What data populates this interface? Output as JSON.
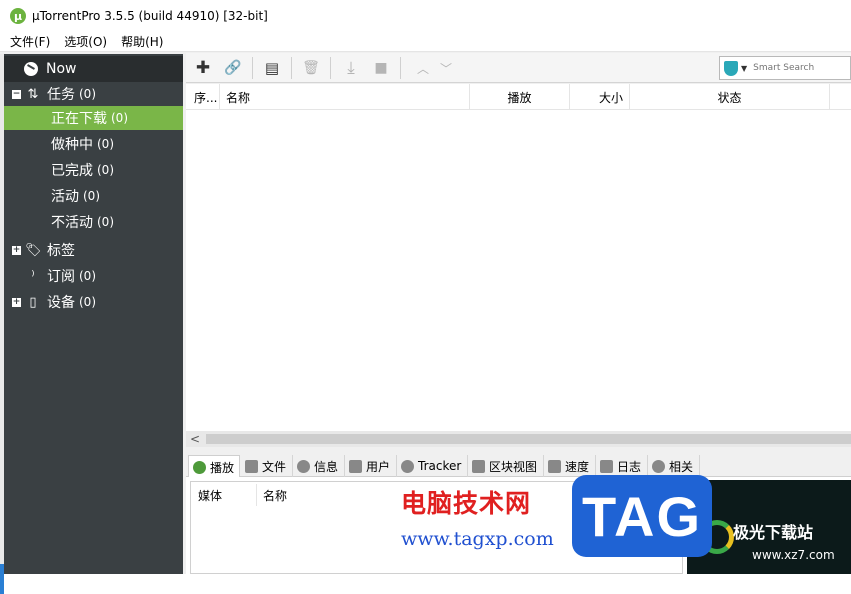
{
  "window": {
    "title": "µTorrentPro 3.5.5  (build 44910) [32-bit]",
    "logo_letter": "µ"
  },
  "menu": [
    "文件(F)",
    "选项(O)",
    "帮助(H)"
  ],
  "sidebar": {
    "now_label": "Now",
    "tasks": {
      "label": "任务",
      "count": "(0)",
      "expander": "−"
    },
    "task_items": [
      {
        "label": "正在下载",
        "count": "(0)",
        "selected": true
      },
      {
        "label": "做种中",
        "count": "(0)",
        "selected": false
      },
      {
        "label": "已完成",
        "count": "(0)",
        "selected": false
      },
      {
        "label": "活动",
        "count": "(0)",
        "selected": false
      },
      {
        "label": "不活动",
        "count": "(0)",
        "selected": false
      }
    ],
    "labels": {
      "label": "标签",
      "expander": "+"
    },
    "feeds": {
      "label": "订阅",
      "count": "(0)"
    },
    "devices": {
      "label": "设备",
      "count": "(0)",
      "expander": "+"
    },
    "colors": {
      "background": "#3a4043",
      "selected": "#7ab648"
    }
  },
  "toolbar": {
    "buttons": [
      {
        "name": "add-torrent",
        "glyph": "✚",
        "enabled": true
      },
      {
        "name": "add-url",
        "glyph": "🔗",
        "enabled": true
      },
      {
        "name": "create-torrent",
        "glyph": "▤",
        "enabled": true
      },
      {
        "name": "remove",
        "glyph": "🗑",
        "enabled": false
      },
      {
        "name": "start",
        "glyph": "⤓",
        "enabled": false
      },
      {
        "name": "stop",
        "glyph": "■",
        "enabled": false
      },
      {
        "name": "move-up",
        "glyph": "︿",
        "enabled": false
      },
      {
        "name": "move-down",
        "glyph": "﹀",
        "enabled": false
      }
    ],
    "search_placeholder": "Smart Search",
    "search_dropdown": "▼"
  },
  "torrent_list": {
    "columns": [
      "序...",
      "名称",
      "播放",
      "大小",
      "状态"
    ]
  },
  "hscroll_arrow": "<",
  "detail_tabs": [
    {
      "label": "播放",
      "active": true
    },
    {
      "label": "文件",
      "active": false
    },
    {
      "label": "信息",
      "active": false
    },
    {
      "label": "用户",
      "active": false
    },
    {
      "label": "Tracker",
      "active": false
    },
    {
      "label": "区块视图",
      "active": false
    },
    {
      "label": "速度",
      "active": false
    },
    {
      "label": "日志",
      "active": false
    },
    {
      "label": "相关",
      "active": false
    }
  ],
  "detail_panel": {
    "columns": [
      "媒体",
      "名称"
    ]
  },
  "watermark": {
    "cn_title": "电脑技术网",
    "url": "www.tagxp.com",
    "tag": "TAG",
    "site": "极光下载站",
    "site_url": "www.xz7.com"
  }
}
